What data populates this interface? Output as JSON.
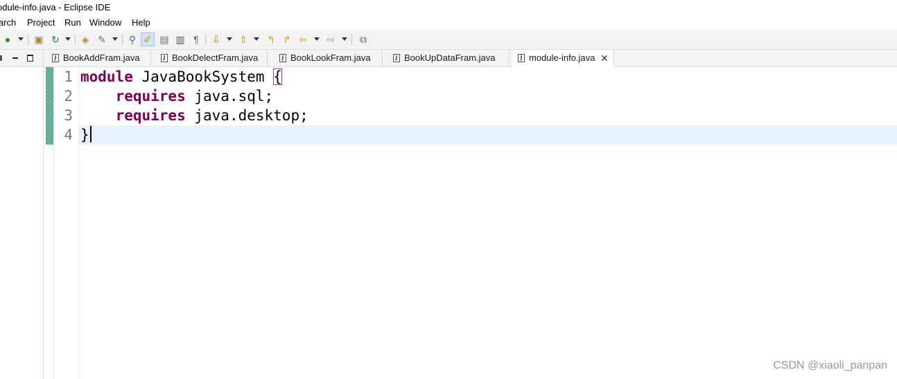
{
  "window": {
    "title": "odule-info.java - Eclipse IDE"
  },
  "menubar": {
    "items": [
      "arch",
      "Project",
      "Run",
      "Window",
      "Help"
    ]
  },
  "toolbar": {
    "icons": [
      "run-icon",
      "new-package-icon",
      "refresh-icon",
      "open-type-icon",
      "search-icon",
      "toggle-mark-occurrences-icon",
      "toggle-highlight-icon",
      "block-selection-icon",
      "show-whitespace-icon",
      "pilcrow-icon",
      "next-annotation-icon",
      "previous-annotation-icon",
      "last-edit-icon",
      "back-icon",
      "forward-icon",
      "open-perspective-icon"
    ]
  },
  "tabs": [
    {
      "label": "BookAddFram.java",
      "active": false
    },
    {
      "label": "BookDelectFram.java",
      "active": false
    },
    {
      "label": "BookLookFram.java",
      "active": false
    },
    {
      "label": "BookUpDataFram.java",
      "active": false
    },
    {
      "label": "module-info.java",
      "active": true,
      "close_label": "✕"
    }
  ],
  "editor": {
    "line_numbers": [
      "1",
      "2",
      "3",
      "4"
    ],
    "lines": [
      {
        "keyword": "module",
        "rest": " JavaBookSystem ",
        "brace": "{"
      },
      {
        "indent": "    ",
        "keyword": "requires",
        "rest": " java.sql;"
      },
      {
        "indent": "    ",
        "keyword": "requires",
        "rest": " java.desktop;"
      },
      {
        "brace": "}"
      }
    ],
    "current_line": 4
  },
  "watermark": "CSDN @xiaoli_panpan",
  "colors": {
    "keyword": "#7f0055",
    "current_line_bg": "#e8f2fe",
    "line_number": "#787878",
    "toolbar_bg": "#f3f3f3"
  }
}
